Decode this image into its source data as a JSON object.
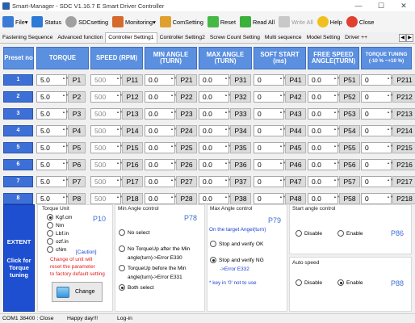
{
  "window": {
    "title": "Smart-Manager - SDC  V1.16.7 E  Smart Driver Controller",
    "minimize": "—",
    "maximize": "☐",
    "close": "✕"
  },
  "toolbar": [
    {
      "label": "File",
      "icon": "file-icon",
      "color": "#3a7bd5",
      "dropdown": true
    },
    {
      "label": "Status",
      "icon": "home-icon",
      "color": "#2d7ad6"
    },
    {
      "label": "SDCsetting",
      "icon": "gear-icon",
      "color": "#a0a0a0"
    },
    {
      "label": "Monitoring",
      "icon": "monitor-icon",
      "color": "#d66a2d",
      "dropdown": true
    },
    {
      "label": "ComSetting",
      "icon": "wrench-icon",
      "color": "#e0a030"
    },
    {
      "label": "Reset",
      "icon": "plus-icon",
      "color": "#46b846"
    },
    {
      "label": "Read All",
      "icon": "up-arrow-icon",
      "color": "#3cb03c"
    },
    {
      "label": "Write All",
      "icon": "down-arrow-icon",
      "color": "#c8c8c8",
      "disabled": true
    },
    {
      "label": "Help",
      "icon": "help-bubble-icon",
      "color": "#f0c020"
    },
    {
      "label": "Close",
      "icon": "close-circle-icon",
      "color": "#e04030"
    }
  ],
  "tabs": [
    "Fastening Sequence",
    "Advanced function",
    "Controller Setting1",
    "Controller Setting2",
    "Screw Count Setting",
    "Multi sequence",
    "Model Setting",
    "Driver ++"
  ],
  "active_tab": 2,
  "columns": [
    "Preset no",
    "TORQUE",
    "SPEED (RPM)",
    "MIN ANGLE (TURN)",
    "MAX ANGLE (TURN)",
    "SOFT START (ms)",
    "FREE SPEED ANGLE(TURN)",
    "TORQUE TUNING (-10 % ~+10 %)"
  ],
  "rows": [
    {
      "no": "1",
      "torque": "5.0",
      "tp": "P1",
      "speed": "500",
      "sp": "P11",
      "min": "0.0",
      "mp": "P21",
      "max": "0.0",
      "xp": "P31",
      "soft": "0",
      "ssp": "P41",
      "free": "0.0",
      "fp": "P51",
      "tune": "0",
      "tup": "P211"
    },
    {
      "no": "2",
      "torque": "5.0",
      "tp": "P2",
      "speed": "500",
      "sp": "P12",
      "min": "0.0",
      "mp": "P22",
      "max": "0.0",
      "xp": "P32",
      "soft": "0",
      "ssp": "P42",
      "free": "0.0",
      "fp": "P52",
      "tune": "0",
      "tup": "P212"
    },
    {
      "no": "3",
      "torque": "5.0",
      "tp": "P3",
      "speed": "500",
      "sp": "P13",
      "min": "0.0",
      "mp": "P23",
      "max": "0.0",
      "xp": "P33",
      "soft": "0",
      "ssp": "P43",
      "free": "0.0",
      "fp": "P53",
      "tune": "0",
      "tup": "P213"
    },
    {
      "no": "4",
      "torque": "5.0",
      "tp": "P4",
      "speed": "500",
      "sp": "P14",
      "min": "0.0",
      "mp": "P24",
      "max": "0.0",
      "xp": "P34",
      "soft": "0",
      "ssp": "P44",
      "free": "0.0",
      "fp": "P54",
      "tune": "0",
      "tup": "P214"
    },
    {
      "no": "5",
      "torque": "5.0",
      "tp": "P5",
      "speed": "500",
      "sp": "P15",
      "min": "0.0",
      "mp": "P25",
      "max": "0.0",
      "xp": "P35",
      "soft": "0",
      "ssp": "P45",
      "free": "0.0",
      "fp": "P55",
      "tune": "0",
      "tup": "P215"
    },
    {
      "no": "6",
      "torque": "5.0",
      "tp": "P6",
      "speed": "500",
      "sp": "P16",
      "min": "0.0",
      "mp": "P26",
      "max": "0.0",
      "xp": "P36",
      "soft": "0",
      "ssp": "P46",
      "free": "0.0",
      "fp": "P56",
      "tune": "0",
      "tup": "P216"
    },
    {
      "no": "7",
      "torque": "5.0",
      "tp": "P7",
      "speed": "500",
      "sp": "P17",
      "min": "0.0",
      "mp": "P27",
      "max": "0.0",
      "xp": "P37",
      "soft": "0",
      "ssp": "P47",
      "free": "0.0",
      "fp": "P57",
      "tune": "0",
      "tup": "P217"
    },
    {
      "no": "8",
      "torque": "5.0",
      "tp": "P8",
      "speed": "500",
      "sp": "P18",
      "min": "0.0",
      "mp": "P28",
      "max": "0.0",
      "xp": "P38",
      "soft": "0",
      "ssp": "P48",
      "free": "0.0",
      "fp": "P58",
      "tune": "0",
      "tup": "P218"
    }
  ],
  "extent": {
    "line1": "EXTENT",
    "line2": "Click for",
    "line3": "Torque",
    "line4": "tuning"
  },
  "torque_unit": {
    "title": "Torque Unit",
    "code": "P10",
    "options": [
      "Kgf.cm",
      "Nm",
      "Lbf.in",
      "ozf.in",
      "cNm"
    ],
    "selected": 0,
    "caution": "[Caution]",
    "warning": [
      "Change of unit will",
      "reset the parameter",
      "to factory default setting"
    ],
    "change_label": "Change"
  },
  "min_angle": {
    "title": "Min Angle control",
    "code": "P78",
    "opt1": "No select",
    "opt2": [
      "No TorqueUp after the Min",
      "angle(turn)->Error E330"
    ],
    "opt3": [
      "TorqueUp before the Min",
      "angle(turn)->Error E331"
    ],
    "opt4": "Both select",
    "selected": 3
  },
  "max_angle": {
    "title": "Max Angle control",
    "code": "P79",
    "subtitle": "On the target Angel(turn)",
    "opt1": "Stop and verify OK",
    "opt2": "Stop and verify NG",
    "opt2_note": "->Error E332",
    "note": "* key in '0' not to use",
    "selected": 1
  },
  "start_angle": {
    "title": "Start angle control",
    "disable": "Disable",
    "enable": "Enable",
    "code": "P86",
    "selected": 0
  },
  "auto_speed": {
    "title": "Auto speed",
    "disable": "Disable",
    "enable": "Enable",
    "code": "P88",
    "selected": 1
  },
  "status": {
    "port": "COM1  38400 : Close",
    "message": "Happy day!!!",
    "login": "Log-in"
  },
  "colors": {
    "header": "#5b8fe0",
    "row_button": "#3d70d6",
    "extent": "#1e4fd1",
    "code": "#3b6fd6",
    "note": "#1a3fd0",
    "warning": "#e02020"
  }
}
